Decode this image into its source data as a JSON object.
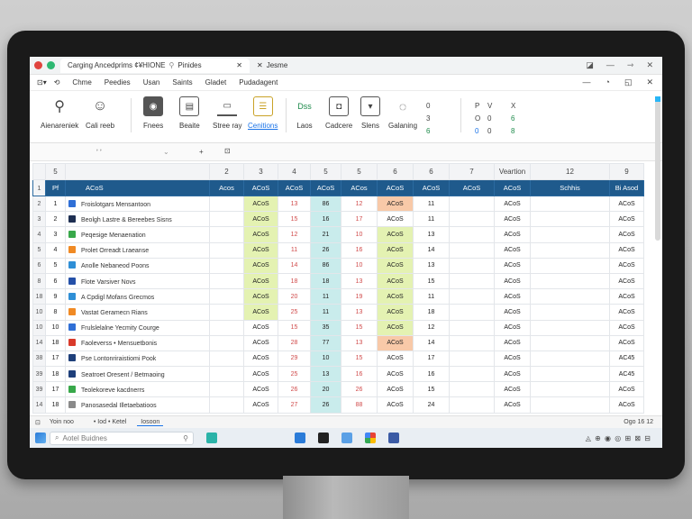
{
  "titlebar": {
    "tab_active": "Carging Ancedprims  ¢¥HIONE",
    "tab_active_extra": "Pinides",
    "tab_inactive": "Jesme"
  },
  "menubar": {
    "items": [
      "Chme",
      "Peedies",
      "Usan",
      "Saints",
      "Gladet",
      "Pudadagent"
    ]
  },
  "ribbon": {
    "buttons": [
      {
        "label": "Aienareniek",
        "icon": "search-icon",
        "glyph": "⚲"
      },
      {
        "label": "Cali reeb",
        "icon": "user-icon",
        "glyph": "☺"
      },
      {
        "label": "Fnees",
        "icon": "camera-icon",
        "glyph": "◉"
      },
      {
        "label": "Beaite",
        "icon": "comment-icon",
        "glyph": "▤"
      },
      {
        "label": "Stree ray",
        "icon": "folder-icon",
        "glyph": "▭"
      },
      {
        "label": "Cenitions",
        "icon": "note-icon",
        "glyph": "☰"
      },
      {
        "label": "Laos",
        "icon": "text-icon",
        "glyph": "Dss"
      },
      {
        "label": "Cadcere",
        "icon": "image-icon",
        "glyph": "◘"
      },
      {
        "label": "Slens",
        "icon": "shape-icon",
        "glyph": "▾"
      },
      {
        "label": "Galaning",
        "icon": "chat-icon",
        "glyph": "◌"
      }
    ],
    "mini_cols": [
      [
        "0",
        "3",
        "6"
      ],
      [
        "P",
        "O",
        "0"
      ],
      [
        "V",
        "0",
        "0"
      ],
      [
        "X",
        "6",
        "8"
      ]
    ]
  },
  "formulabar": {
    "cell_ref": "ʼ ʼ",
    "divider": "+"
  },
  "grid": {
    "col_headers": [
      "5",
      "",
      "2",
      "3",
      "4",
      "5",
      "5",
      "6",
      "6",
      "7",
      "Veartion",
      "12",
      "9",
      "9"
    ],
    "header_row": {
      "rn": "1",
      "cells": [
        "Pf",
        "ACoS",
        "Acos",
        "ACoS",
        "ACoS",
        "ACoS",
        "ACos",
        "ACoS",
        "ACoS",
        "ACoS",
        "ACoS",
        "",
        "Schhis",
        "Bi Asod"
      ]
    },
    "rows": [
      {
        "rn": "2",
        "n": "1",
        "color": "#2f6fd6",
        "name": "Froislotgars Mensantoon",
        "a": "ACoS",
        "b": "13",
        "c": "86",
        "d": "12",
        "e": "ACoS",
        "f": "11",
        "g": "ACoS",
        "h": "ACoS"
      },
      {
        "rn": "3",
        "n": "2",
        "color": "#1e2f52",
        "name": "Beolgh Lastre & Bereebes Sisns",
        "a": "ACoS",
        "b": "15",
        "c": "16",
        "d": "17",
        "e": "ACoS",
        "f": "11",
        "g": "ACoS",
        "h": "ACoS"
      },
      {
        "rn": "4",
        "n": "3",
        "color": "#38a84a",
        "name": "Peqesige Menaenation",
        "a": "ACoS",
        "b": "12",
        "c": "21",
        "d": "10",
        "e": "ACoS",
        "f": "13",
        "g": "ACoS",
        "h": "ACoS"
      },
      {
        "rn": "5",
        "n": "4",
        "color": "#f08a24",
        "name": "Prolet Orreadt Lraeanse",
        "a": "ACoS",
        "b": "11",
        "c": "26",
        "d": "16",
        "e": "ACoS",
        "f": "14",
        "g": "ACoS",
        "h": "ACoS"
      },
      {
        "rn": "6",
        "n": "5",
        "color": "#2f8fd6",
        "name": "Anolle Nebaneod Poons",
        "a": "ACoS",
        "b": "14",
        "c": "86",
        "d": "10",
        "e": "ACoS",
        "f": "13",
        "g": "ACoS",
        "h": "ACoS"
      },
      {
        "rn": "8",
        "n": "6",
        "color": "#2450a8",
        "name": "Flote Varsiver Novs",
        "a": "ACoS",
        "b": "18",
        "c": "18",
        "d": "13",
        "e": "ACoS",
        "f": "15",
        "g": "ACoS",
        "h": "ACoS"
      },
      {
        "rn": "18",
        "n": "9",
        "color": "#2f8fd6",
        "name": "A  Cpdigl Mofans Grecmos",
        "a": "ACoS",
        "b": "20",
        "c": "11",
        "d": "19",
        "e": "ACoS",
        "f": "11",
        "g": "ACoS",
        "h": "ACoS"
      },
      {
        "rn": "10",
        "n": "8",
        "color": "#f08a24",
        "name": "Vastat Geramecn Rians",
        "a": "ACoS",
        "b": "25",
        "c": "11",
        "d": "13",
        "e": "ACoS",
        "f": "18",
        "g": "ACoS",
        "h": "ACoS"
      },
      {
        "rn": "10",
        "n": "10",
        "color": "#2f6fd6",
        "name": "Frulslelalne Yecmity Courge",
        "a": "ACoS",
        "b": "15",
        "c": "35",
        "d": "15",
        "e": "ACoS",
        "f": "12",
        "g": "ACoS",
        "h": "ACoS"
      },
      {
        "rn": "14",
        "n": "18",
        "color": "#d93a2b",
        "name": "Faoleverss • Mensuetbonis",
        "a": "ACoS",
        "b": "28",
        "c": "77",
        "d": "13",
        "e": "ACoS",
        "f": "14",
        "g": "ACoS",
        "h": "ACoS"
      },
      {
        "rn": "38",
        "n": "17",
        "color": "#1e3f7a",
        "name": "Pse Lontonriraistiomi Pook",
        "a": "ACoS",
        "b": "29",
        "c": "10",
        "d": "15",
        "e": "ACoS",
        "f": "17",
        "g": "ACoS",
        "h": "AC45"
      },
      {
        "rn": "39",
        "n": "18",
        "color": "#1e3f7a",
        "name": "Seatroet Oresent / Betmaoing",
        "a": "ACoS",
        "b": "25",
        "c": "13",
        "d": "16",
        "e": "ACoS",
        "f": "16",
        "g": "ACoS",
        "h": "AC45"
      },
      {
        "rn": "39",
        "n": "17",
        "color": "#38a84a",
        "name": "Teolekoreve kacdnerrs",
        "a": "ACoS",
        "b": "26",
        "c": "20",
        "d": "26",
        "e": "ACoS",
        "f": "15",
        "g": "ACoS",
        "h": "ACoS"
      },
      {
        "rn": "14",
        "n": "18",
        "color": "#8a8a8a",
        "name": "Panosasedal Illetaebatioos",
        "a": "ACoS",
        "b": "27",
        "c": "26",
        "d": "88",
        "e": "ACoS",
        "f": "24",
        "g": "ACoS",
        "h": "ACoS"
      }
    ]
  },
  "statusbar": {
    "left": "Yoin noo",
    "mid": "• Iod   • Ketel",
    "tab": "Iosoon",
    "right": "Ogo  16  12"
  },
  "taskbar": {
    "search_placeholder": "Aotel Buidnes",
    "tray": "◬  ⊕  ◉  ◎  ⊞  ⊠  ⊟"
  }
}
